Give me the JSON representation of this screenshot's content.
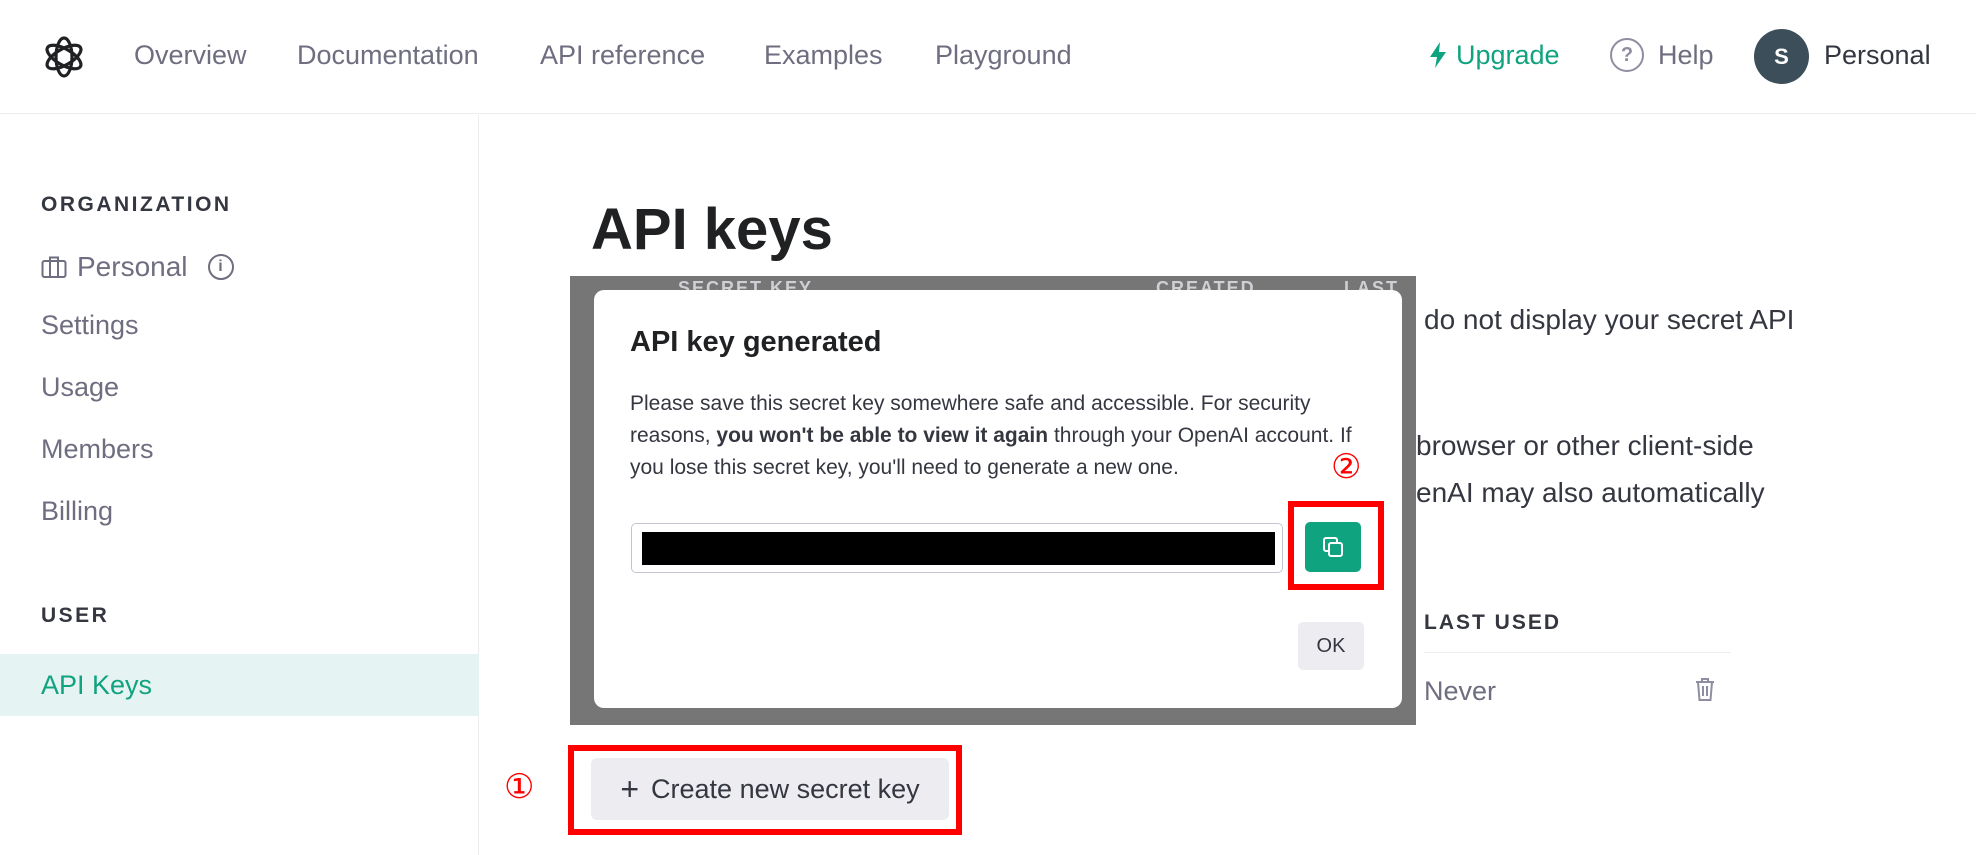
{
  "nav": {
    "links": [
      "Overview",
      "Documentation",
      "API reference",
      "Examples",
      "Playground"
    ],
    "upgrade": "Upgrade",
    "help": "Help",
    "help_glyph": "?",
    "avatar_initial": "S",
    "org": "Personal",
    "accent": "#10a37f"
  },
  "sidebar": {
    "org_heading": "ORGANIZATION",
    "org_name": "Personal",
    "info_glyph": "i",
    "items": [
      "Settings",
      "Usage",
      "Members",
      "Billing"
    ],
    "user_heading": "USER",
    "active_item": "API Keys"
  },
  "main": {
    "title": "API keys",
    "bg_lines": [
      "do not display your secret API",
      "browser or other client-side",
      "enAI may also automatically"
    ],
    "bg_ghost_headers": [
      "SECRET KEY",
      "CREATED",
      "LAST U"
    ],
    "col_header": "LAST USED",
    "last_used": "Never",
    "create_button": "Create new secret key",
    "create_plus": "+"
  },
  "modal": {
    "title": "API key generated",
    "body_1": "Please save this secret key somewhere safe and accessible. For security reasons, ",
    "body_bold": "you won't be able to view it again",
    "body_2": " through your OpenAI account. If you lose this secret key, you'll need to generate a new one.",
    "ok": "OK"
  },
  "annotations": {
    "step1": "①",
    "step2": "②",
    "color": "#ff0000"
  }
}
